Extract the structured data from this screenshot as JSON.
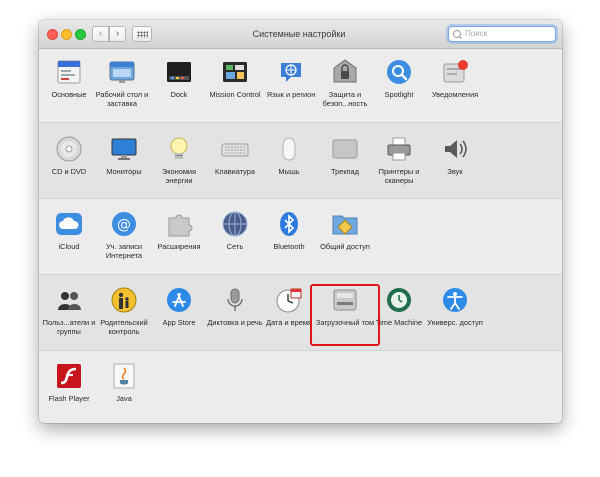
{
  "window": {
    "title": "Системные настройки",
    "search_placeholder": "Поиск",
    "back_glyph": "‹",
    "forward_glyph": "›"
  },
  "highlighted_item": "Загрузочный том",
  "sections": [
    {
      "items": [
        {
          "name": "general-icon",
          "label": "Основные"
        },
        {
          "name": "desktop-screensaver-icon",
          "label": "Рабочий стол и заставка"
        },
        {
          "name": "dock-icon",
          "label": "Dock"
        },
        {
          "name": "mission-control-icon",
          "label": "Mission Control"
        },
        {
          "name": "language-region-icon",
          "label": "Язык и регион"
        },
        {
          "name": "security-icon",
          "label": "Защита и безоп...ность"
        },
        {
          "name": "spotlight-icon",
          "label": "Spotlight"
        },
        {
          "name": "notifications-icon",
          "label": "Уведомления"
        }
      ]
    },
    {
      "items": [
        {
          "name": "cd-dvd-icon",
          "label": "CD и DVD"
        },
        {
          "name": "displays-icon",
          "label": "Мониторы"
        },
        {
          "name": "energy-saver-icon",
          "label": "Экономия энергии"
        },
        {
          "name": "keyboard-icon",
          "label": "Клавиатура"
        },
        {
          "name": "mouse-icon",
          "label": "Мышь"
        },
        {
          "name": "trackpad-icon",
          "label": "Трекпад"
        },
        {
          "name": "printers-icon",
          "label": "Принтеры и сканеры"
        },
        {
          "name": "sound-icon",
          "label": "Звук"
        }
      ]
    },
    {
      "items": [
        {
          "name": "icloud-icon",
          "label": "iCloud"
        },
        {
          "name": "internet-accounts-icon",
          "label": "Уч. записи Интернета"
        },
        {
          "name": "extensions-icon",
          "label": "Расширения"
        },
        {
          "name": "network-icon",
          "label": "Сеть"
        },
        {
          "name": "bluetooth-icon",
          "label": "Bluetooth"
        },
        {
          "name": "sharing-icon",
          "label": "Общий доступ"
        }
      ]
    },
    {
      "items": [
        {
          "name": "users-groups-icon",
          "label": "Польз...атели и группы"
        },
        {
          "name": "parental-controls-icon",
          "label": "Родительский контроль"
        },
        {
          "name": "app-store-icon",
          "label": "App Store"
        },
        {
          "name": "dictation-icon",
          "label": "Диктовка и речь"
        },
        {
          "name": "date-time-icon",
          "label": "Дата и время"
        },
        {
          "name": "startup-disk-icon",
          "label": "Загрузочный том"
        },
        {
          "name": "time-machine-icon",
          "label": "Time Machine"
        },
        {
          "name": "accessibility-icon",
          "label": "Универс. доступ"
        }
      ]
    },
    {
      "items": [
        {
          "name": "flash-player-icon",
          "label": "Flash Player"
        },
        {
          "name": "java-icon",
          "label": "Java"
        }
      ]
    }
  ]
}
